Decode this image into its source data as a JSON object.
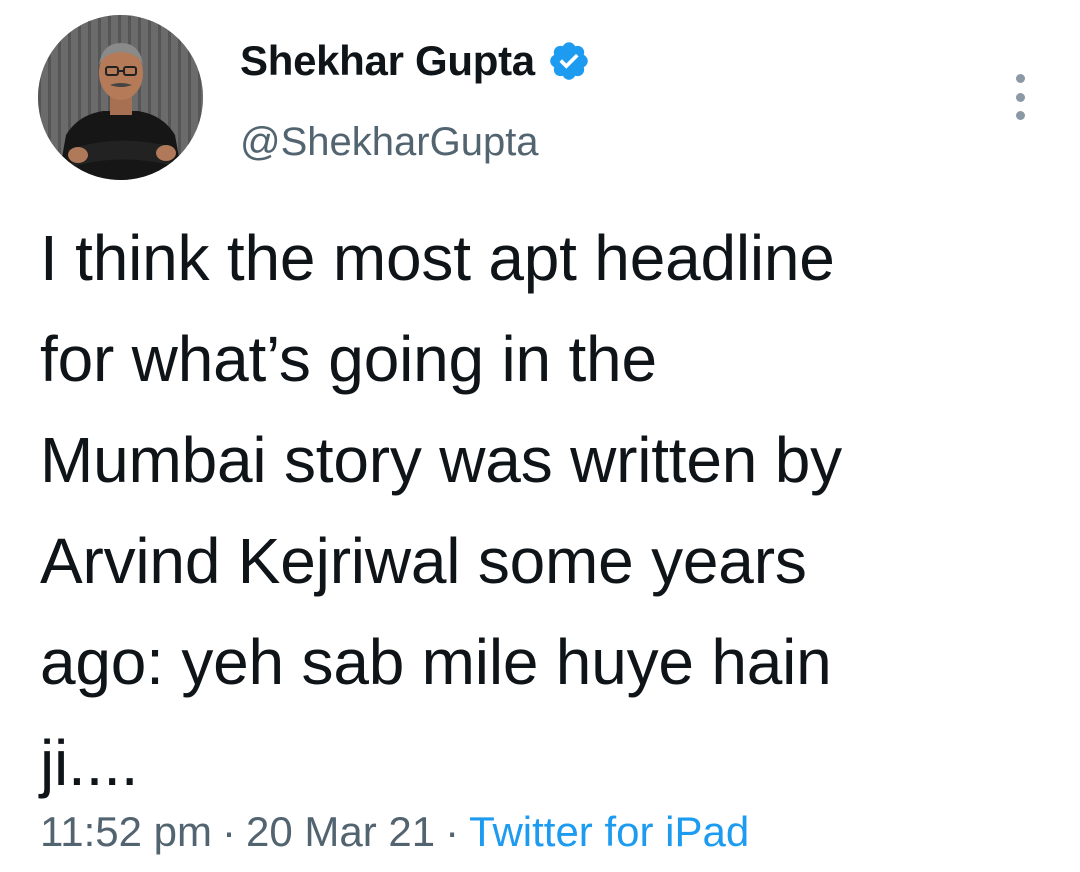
{
  "user": {
    "display_name": "Shekhar Gupta",
    "handle": "@ShekharGupta",
    "verified": true,
    "verified_color": "#1d9bf0",
    "avatar_icon": "profile-photo"
  },
  "tweet": {
    "lines": [
      "I think the most apt headline",
      "for what’s going in the",
      "Mumbai story was written by",
      "Arvind Kejriwal some years",
      "ago: yeh sab mile huye hain",
      "ji...."
    ]
  },
  "meta": {
    "time": "11:52 pm",
    "separator": "·",
    "date": "20 Mar 21",
    "source": "Twitter for iPad",
    "source_color": "#1d9bf0"
  },
  "menu": {
    "icon": "more-vertical-icon"
  }
}
